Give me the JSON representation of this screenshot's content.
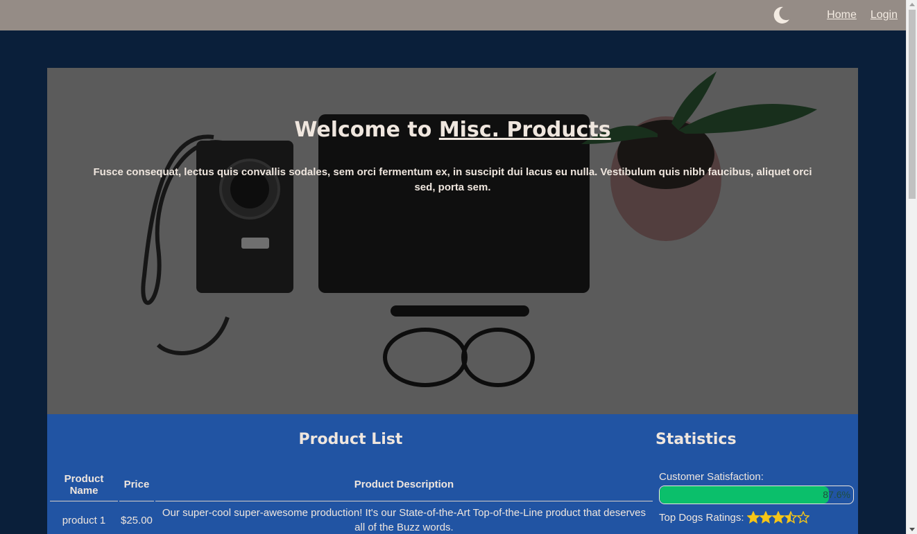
{
  "nav": {
    "home_label": "Home",
    "login_label": "Login",
    "theme_icon": "moon-icon"
  },
  "hero": {
    "title_prefix": "Welcome to ",
    "brand": "Misc. Products",
    "subtitle": "Fusce consequat, lectus quis convallis sodales, sem orci fermentum ex, in suscipit dui lacus eu nulla. Vestibulum quis nibh faucibus, aliquet orci sed, porta sem."
  },
  "products": {
    "title": "Product List",
    "columns": [
      "Product Name",
      "Price",
      "Product Description"
    ],
    "rows": [
      {
        "name": "product 1",
        "price": "$25.00",
        "description": "Our super-cool super-awesome production! It's our State-of-the-Art Top-of-the-Line product that deserves all of the Buzz words."
      }
    ]
  },
  "stats": {
    "title": "Statistics",
    "satisfaction_label": "Customer Satisfaction:",
    "satisfaction_text": "87.6%",
    "satisfaction_value": 0.876,
    "ratings_label": "Top Dogs Ratings:",
    "rating_value": 3.5,
    "rating_max": 5
  },
  "colors": {
    "accent": "#2154a3",
    "background": "#0a1f3a",
    "topbar": "#958c86",
    "progress": "#0bbf6b",
    "star": "#f5c518"
  }
}
